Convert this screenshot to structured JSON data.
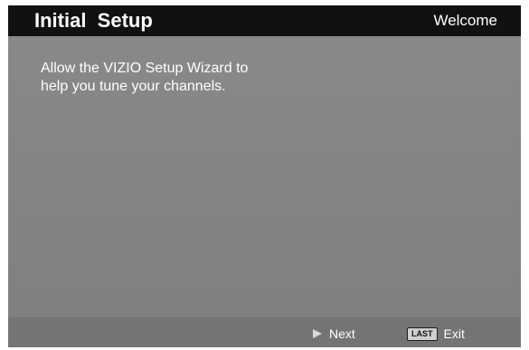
{
  "header": {
    "title": "Initial  Setup",
    "right_label": "Welcome"
  },
  "message": {
    "line1": "Allow the VIZIO Setup Wizard to",
    "line2": "help you tune your channels."
  },
  "footer": {
    "next_label": "Next",
    "next_icon": "play-icon",
    "last_key_label": "LAST",
    "exit_label": "Exit"
  }
}
